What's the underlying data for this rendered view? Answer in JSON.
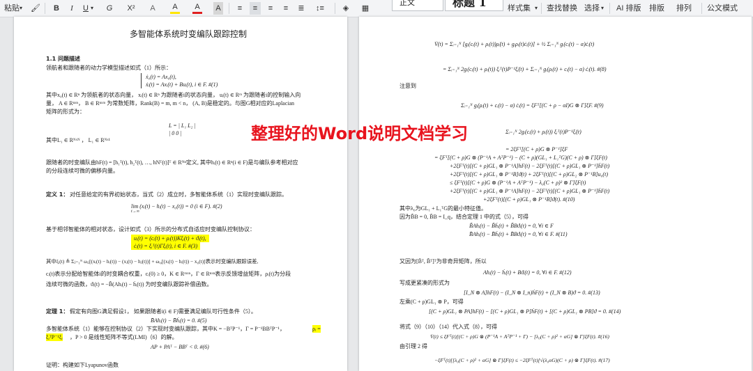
{
  "toolbar": {
    "paste": "粘贴",
    "paste_arrow": "▾",
    "format_painter": "🖌",
    "bold": "B",
    "italic": "I",
    "underline": "U",
    "underline_arrow": "▾",
    "strike": "G",
    "superscript": "X²",
    "text_effect": "A",
    "highlight": "A",
    "font_color": "A",
    "char_shade": "A",
    "align_left": "≡",
    "align_center": "≡",
    "align_right": "≡",
    "justify": "≡",
    "distributed": "≣",
    "line_spacing": "↕≡",
    "shading": "◈",
    "borders": "▦",
    "style_normal": "正文",
    "style_heading1": "标题 1",
    "style_set": "样式集",
    "find_replace": "查找替换",
    "select": "选择",
    "ai_layout": "AI 排版",
    "layout": "排版",
    "arrange": "排列",
    "formula_mode": "公文模式"
  },
  "watermark": "整理好的Word说明文档学习",
  "left_page": {
    "title": "多智能体系统时变编队跟踪控制",
    "section": "1.1 问题描述",
    "p1": "领航者和跟随者的动力学模型描述如式（1）所示：",
    "eq1a": "ẋ₀(t) = Ax₀(t),",
    "eq1b": "ẋᵢ(t) = Axᵢ(t) + Buᵢ(t), i ∈ F. #(1)",
    "p2a": "其中x₀(t) ∈ Rⁿ 为领航者的状态向量， xᵢ(t) ∈ Rⁿ 为跟随者i的状态向量， uᵢ(t) ∈ Rᵐ 为跟随者i的控制输入向",
    "p2b": "量， A ∈ Rⁿˣⁿ， B ∈ Rⁿˣᵐ 为常数矩阵，Rank(B) = m, m < n， (A, B)是稳定的。与图G相对应的Laplacian",
    "p2c": "矩阵的形式为：",
    "eq_L": "L = | L₁  L₂ |",
    "eq_L2": "      | 0   0  |",
    "p3": "其中L₁ ∈ Rᴺˣᴺ ， L₁ ∈ Rᴺˣ¹",
    "p4a": "跟随者的时变编队由hF(t) = [h₁ᵀ(t), h₂ᵀ(t), …, hNᵀ(t)]ᵀ ∈ Rᴺⁿ定义, 其中hᵢ(t) ∈ Rⁿ(i ∈ F)是与编队参考相对应",
    "p4b": "的分段连续可微的偏移向量。",
    "def1": "定义 1：",
    "def1_text": "对任意给定的有界初始状态，当式（2）成立时，多智能体系统（1）实现时变编队跟踪。",
    "eq2": "lim (xᵢ(t) − hᵢ(t) − x₀(t)) = 0 (i ∈ F). #(2)",
    "eq2_sub": "t→∞",
    "p5": "基于相邻智能体的相对状态，设计如式（3）所示的分布式自适应时变编队控制协议：",
    "eq3a": "uᵢ(t) = (cᵢ(t) + ρᵢ(t))Kξᵢ(t) + ϑᵢ(t),",
    "eq3b": "ċᵢ(t) = ξᵢᵀ(t)Γξᵢ(t), i ∈ F. #(3)",
    "p6a": "其中ξᵢ(t) ≜ Σⱼ₌₁ᴺ ωᵢⱼ[(xᵢ(t) − hᵢ(t)) − (xⱼ(t) − hⱼ(t))] + ωᵢ₀[(xᵢ(t) − hᵢ(t)) − x₀(t)]表示时变编队跟踪误差,",
    "p6b": "cᵢ(t)表示分配给智能体i的时变耦合权重，cᵢ(0) ≥ 0，K ∈ Rᵐˣⁿ，Γ ∈ Rⁿˣⁿ表示反馈增益矩阵，ρᵢ(t)为分段",
    "p6c": "连续可微的函数，ϑᵢ(t) = −B̃(Ahᵢ(t) − ḣᵢ(t)) 为时变编队跟踪补偿函数。",
    "thm1": "定理 1：",
    "thm1_text": "假定有向图G满足假设1， 如果跟随者i(i ∈ F)需要满足编队可行性条件（5）。",
    "eq5": "B̄Ahᵢ(t) − B̄ḣᵢ(t) = 0. #(5)",
    "p7a": "多智能体系统（1）能够在控制协议（2）下实现时变编队跟踪，其中K = −BᵀP⁻¹，Γ = P⁻¹BBᵀP⁻¹，",
    "p7a_hl": "ρᵢ =",
    "p7b_hl": "ξᵢᵀP⁻¹ξᵢ",
    "p7b": "，P > 0 是线性矩阵不等式(LMI)（6）的解。",
    "eq6": "AP + PAᵀ − BBᵀ < 0. #(6)",
    "proof": "证明：构建如下Lyapunov函数"
  },
  "right_page": {
    "e1": "V̇(t) = Σᵢ₌₁ᴺ [gᵢ(cᵢ(t) + ρᵢ(t))ρ̇ᵢ(t) + gᵢρᵢ(t)ċᵢ(t)] + ½ Σᵢ₌₁ᴺ gᵢ(cᵢ(t) − α)ċᵢ(t)",
    "e2": "= Σᵢ₌₁ᴺ 2gᵢ(cᵢ(t) + ρᵢ(t)) ξᵢᵀ(t)P⁻¹ξ̇ᵢ(t) + Σᵢ₌₁ᴺ gᵢ(ρᵢ(t) + cᵢ(t) − α) ċᵢ(t). #(8)",
    "note": "注意到",
    "e9": "Σᵢ₌₁ᴺ gᵢ(ρᵢ(t) + cᵢ(t) − α) ċᵢ(t) = ξFᵀ[(C + ρ − αI)G ⊗ Γ]ξF. #(9)",
    "e10a": "Σᵢ₌₁ᴺ 2gᵢ(cᵢ(t) + ρᵢ(t)) ξᵢᵀ(t)P⁻¹ξ̇ᵢ(t)",
    "e10b": "= 2ξFᵀ[(C + ρ)G ⊗ P⁻¹]ξ̇F",
    "e10c": "= ξFᵀ[(C + ρ)G ⊗ (P⁻¹A + AᵀP⁻¹) − (C + ρ)(GL₁ + L₁ᵀG)(C + ρ) ⊗ Γ]ξF(t)",
    "e10d": "+2ξFᵀ(t)[(C + ρ)GL₁ ⊗ P⁻¹A]hF(t) − 2ξFᵀ(t)[(C + ρ)GL₁ ⊗ P⁻¹]ḣF(t)",
    "e10e": "+2ξFᵀ(t)[(C + ρ)GL₁ ⊗ P⁻¹B]ϑ(t) + 2ξFᵀ(t)[(C + ρ)GL₂ ⊗ P⁻¹B]u₀(t)",
    "e10f": "≤ ξFᵀ(t)[(C + ρ)G ⊗ (P⁻¹A + AᵀP⁻¹) − λ₀(C + ρ)² ⊗ Γ]ξF(t)",
    "e10g": "+2ξFᵀ(t)[(C + ρ)GL₁ ⊗ P⁻¹A]hF(t) − 2ξFᵀ(t)[(C + ρ)GL₁ ⊗ P⁻¹]ḣF(t)",
    "e10h": "+2ξFᵀ(t)[(C + ρ)GL₁ ⊗ P⁻¹B]ϑ(t). #(10)",
    "t1": "其中λ₀为GL₁ + L₁ᵀG的最小特征值。",
    "t2": "因为B̃B = 0, B̄B = I_q，结合定理 1 中的式（5），可得",
    "e11a": "B̃Ahᵢ(t) − B̃ḣᵢ(t) + B̃Bϑᵢ(t) = 0, ∀i ∈ F",
    "e11b": "B̄Ahᵢ(t) − B̄ḣᵢ(t) + B̄Bϑᵢ(t) = 0, ∀i ∈ F. #(11)",
    "t3": "又因为[B̄ᵀ, B̃ᵀ]ᵀ为非奇异矩阵，所以",
    "e12": "Ahᵢ(t) − ḣᵢ(t) + Bϑᵢ(t) = 0, ∀i ∈ F. #(12)",
    "t4": "写成更紧凑的形式为",
    "e13": "[I_N ⊗ A]hF(t) − (I_N ⊗ I_n)ḣF(t) + (I_N ⊗ B)ϑ = 0. #(13)",
    "t5": "左乘(C + ρ)GL₁ ⊗ P，可得",
    "e14": "[(C + ρ)GL₁ ⊗ PA]hF(t) − [(C + ρ)GL₁ ⊗ P]ḣF(t) + [(C + ρ)GL₁ ⊗ PB]ϑ = 0. #(14)",
    "t6": "将式（9）（10）（14）代入式（8），可得",
    "e16": "V̇(t) ≤ ξFᵀ(t)[(C + ρ)G ⊗ (P⁻¹A + AᵀP⁻¹ + Γ) − [λ₀(C + ρ)² + αG] ⊗ Γ]ξF(t). #(16)",
    "t7": "由引理 2 得",
    "e17": "−ξFᵀ(t)[[λ₀(C + ρ)² + αG] ⊗ Γ]ξF(t) ≤ −2ξFᵀ(t)[√(λ₀αG)(C + ρ) ⊗ Γ]ξF(t). #(17)"
  }
}
